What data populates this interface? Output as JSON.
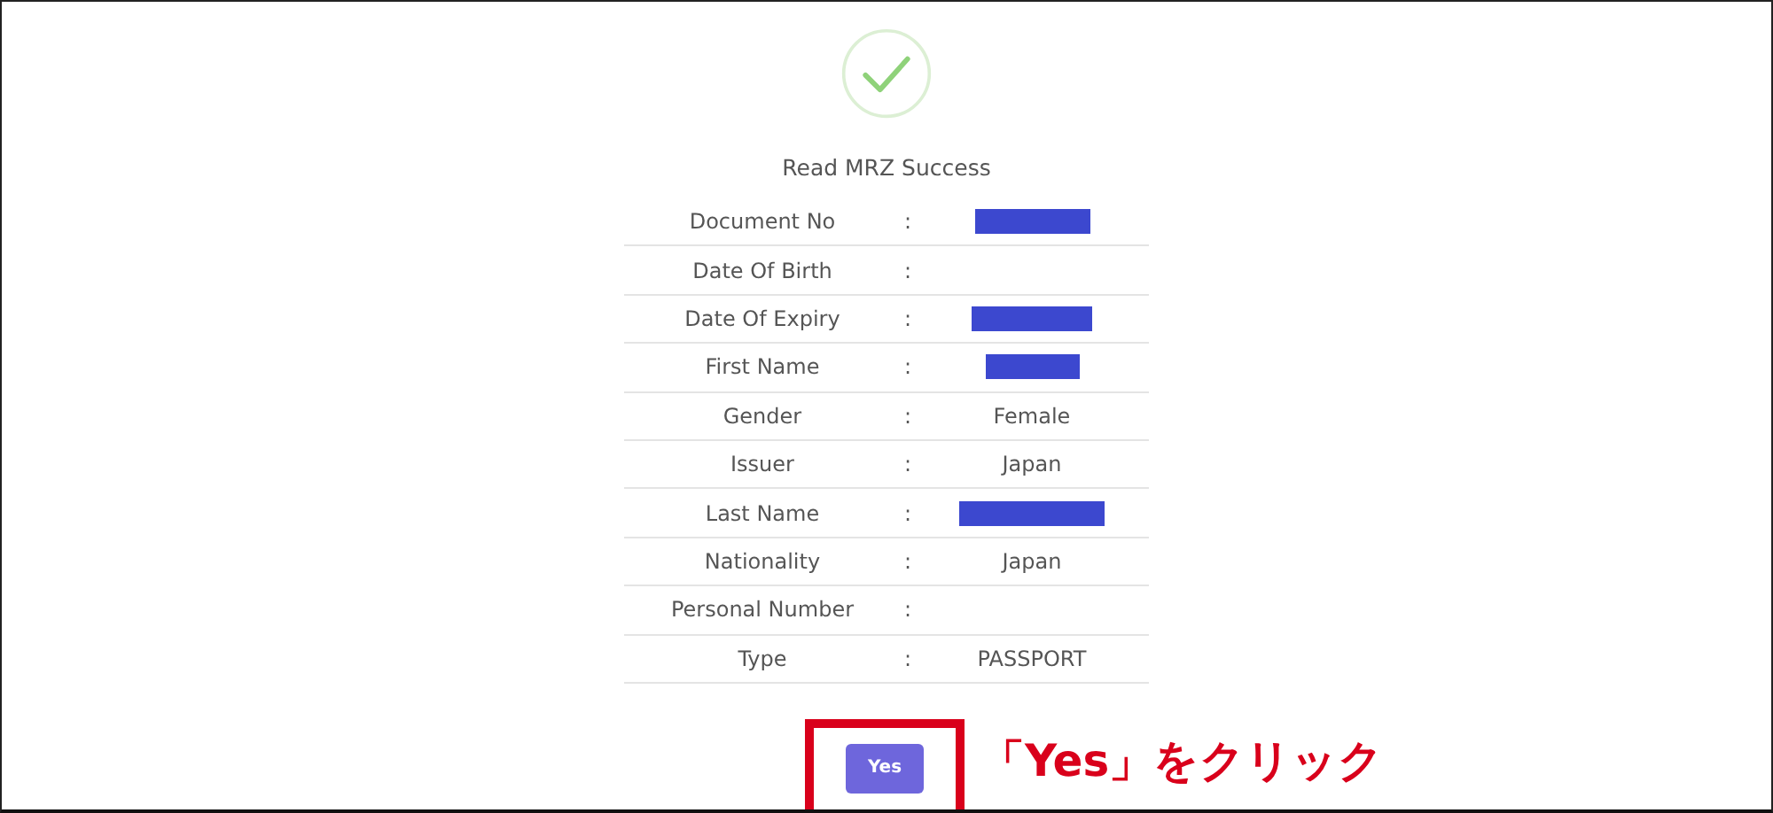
{
  "title": "Read MRZ Success",
  "rows": [
    {
      "label": "Document No",
      "separator": ":",
      "value": {
        "kind": "redacted"
      }
    },
    {
      "label": "Date Of Birth",
      "separator": ":"
    },
    {
      "label": "Date Of Expiry",
      "separator": ":",
      "value": {
        "kind": "redacted"
      }
    },
    {
      "label": "First Name",
      "separator": ":",
      "value": {
        "kind": "redacted"
      }
    },
    {
      "label": "Gender",
      "separator": ":",
      "value": {
        "kind": "text",
        "text": "Female"
      }
    },
    {
      "label": "Issuer",
      "separator": ":",
      "value": {
        "kind": "text",
        "text": "Japan"
      }
    },
    {
      "label": "Last Name",
      "separator": ":",
      "value": {
        "kind": "redacted"
      }
    },
    {
      "label": "Nationality",
      "separator": ":",
      "value": {
        "kind": "text",
        "text": "Japan"
      }
    },
    {
      "label": "Personal Number",
      "separator": ":"
    },
    {
      "label": "Type",
      "separator": ":",
      "value": {
        "kind": "text",
        "text": "PASSPORT"
      }
    }
  ],
  "button": {
    "label": "Yes"
  },
  "annotation": "「Yes」をクリック"
}
